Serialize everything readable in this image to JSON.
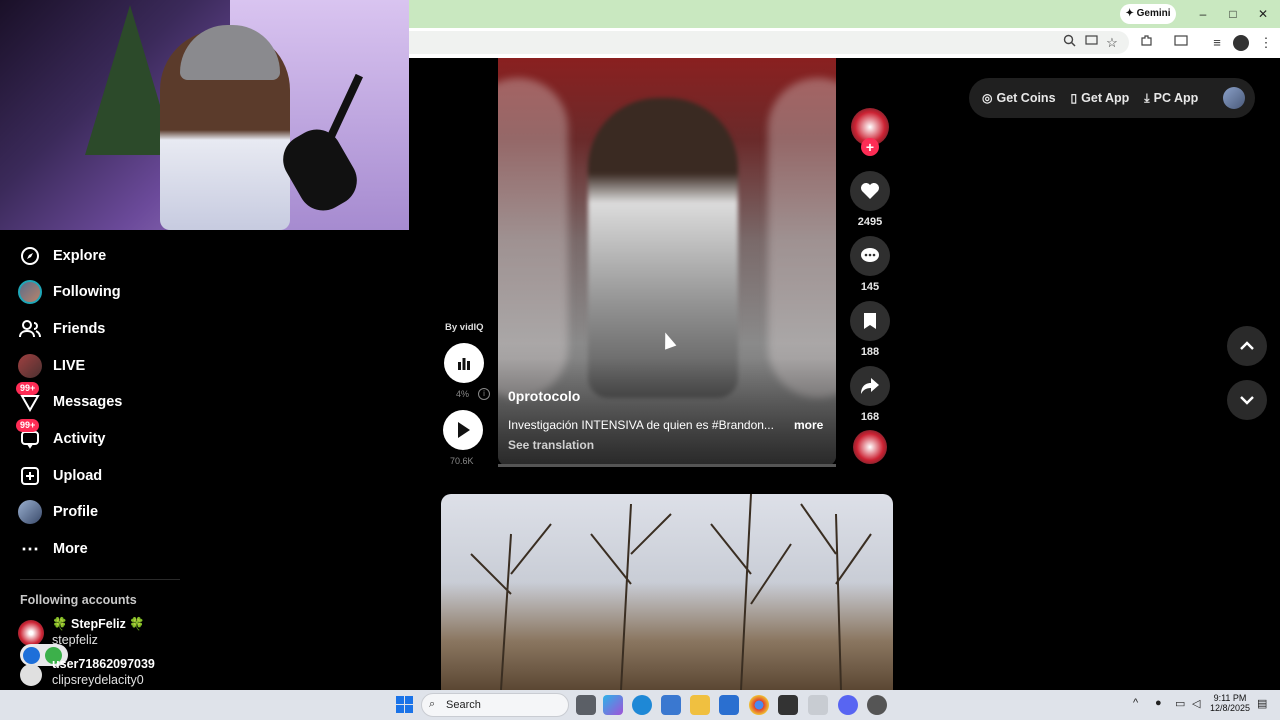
{
  "browser": {
    "gemini_label": "Gemini",
    "window_controls": [
      "–",
      "□",
      "✕"
    ]
  },
  "sidebar": {
    "items": [
      {
        "label": "Explore",
        "icon": "compass-icon"
      },
      {
        "label": "Following",
        "icon": "following-avatar"
      },
      {
        "label": "Friends",
        "icon": "friends-icon"
      },
      {
        "label": "LIVE",
        "icon": "live-avatar"
      },
      {
        "label": "Messages",
        "icon": "messages-icon",
        "badge": "99+"
      },
      {
        "label": "Activity",
        "icon": "activity-icon",
        "badge": "99+"
      },
      {
        "label": "Upload",
        "icon": "upload-icon"
      },
      {
        "label": "Profile",
        "icon": "profile-avatar"
      },
      {
        "label": "More",
        "icon": "more-icon"
      }
    ],
    "following_title": "Following accounts",
    "accounts": [
      {
        "name": "🍀 StepFeliz 🍀",
        "handle": "stepfeliz"
      },
      {
        "name": "user71862097039",
        "handle": "clipsreydelacity0"
      }
    ]
  },
  "video": {
    "author": "0protocolo",
    "caption": "Investigación INTENSIVA de quien es #Brandon...",
    "more_label": "more",
    "translate_label": "See translation",
    "likes": "2495",
    "comments": "145",
    "saves": "188",
    "shares": "168"
  },
  "vidiq": {
    "by_label": "By vidIQ",
    "percent": "4%",
    "views": "70.6K"
  },
  "top_pill": {
    "get_coins": "Get Coins",
    "get_app": "Get App",
    "pc_app": "PC App"
  },
  "taskbar": {
    "search_label": "Search",
    "time": "9:11 PM",
    "date": "12/8/2025"
  },
  "colors": {
    "accent": "#fe2c55",
    "titlebar": "#c9e8c0",
    "taskbar": "#dfe3ea"
  }
}
